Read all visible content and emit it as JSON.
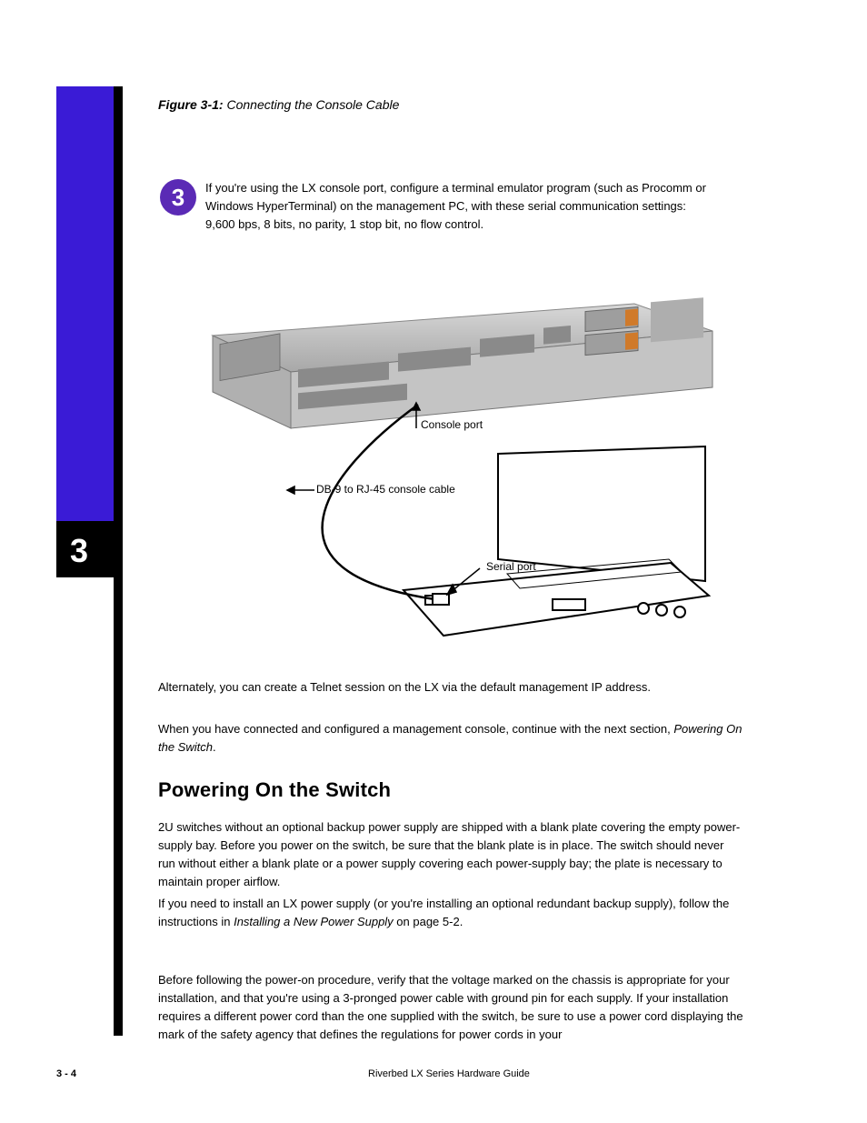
{
  "chapter_num": "3",
  "figure": {
    "label": "Figure 3-1: ",
    "title": "Connecting the Console Cable"
  },
  "step": {
    "number": "3",
    "text": "If you're using the LX console port, configure a terminal emulator program (such as Procomm or Windows HyperTerminal) on the management PC, with these serial communication settings: 9,600 bps, 8 bits, no parity, 1 stop bit, no flow control."
  },
  "labels": {
    "console_port": "Console port",
    "db9": "DB-9 to RJ-45 console cable",
    "serial_port": "Serial port"
  },
  "body": {
    "p1": "Alternately, you can create a Telnet session on the LX via the default management IP address.",
    "p2_pre": "When you have connected and configured a management console, continue with the next section, ",
    "p2_em": "Powering On the Switch",
    "p2_post": "."
  },
  "section": {
    "heading": "Powering On the Switch",
    "p1": "2U switches without an optional backup power supply are shipped with a blank plate covering the empty power-supply bay. Before you power on the switch, be sure that the blank plate is in place. The switch should never run without either a blank plate or a power supply covering each power-supply bay; the plate is necessary to maintain proper airflow.",
    "p2_pre": "If you need to install an LX power supply (or you're installing an optional redundant backup supply), follow the instructions in ",
    "p2_em": "Installing a New Power Supply",
    "p2_post": " on page 5-2.",
    "p3": "Before following the power-on procedure, verify that the voltage marked on the chassis is appropriate for your installation, and that you're using a 3-pronged power cable with ground pin for each supply. If your installation requires a different power cord than the one supplied with the switch, be sure to use a power cord displaying the mark of the safety agency that defines the regulations for power cords in your"
  },
  "footer": {
    "page": "3 - 4",
    "doc": "Riverbed LX Series Hardware Guide"
  }
}
